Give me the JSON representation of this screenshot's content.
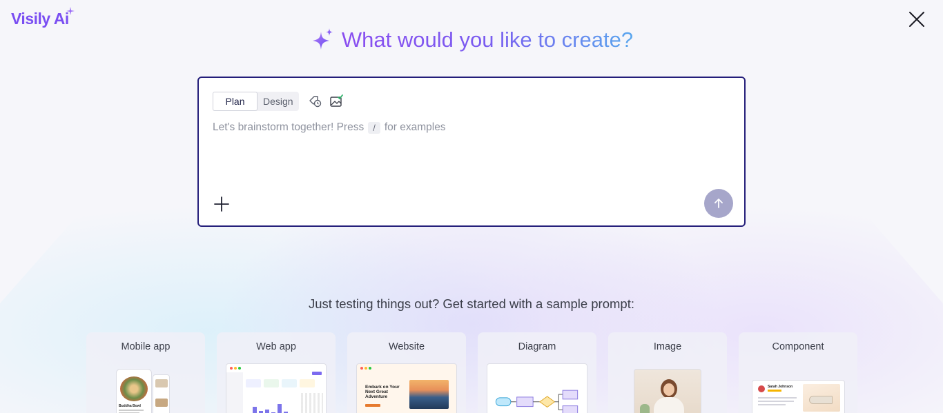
{
  "app": {
    "logo_text": "Visily Ai"
  },
  "headline": {
    "text": "What would you like to create?"
  },
  "prompt": {
    "modes": [
      "Plan",
      "Design"
    ],
    "active_mode": "Plan",
    "placeholder_before": "Let's brainstorm together! Press",
    "placeholder_key": "/",
    "placeholder_after": "for examples"
  },
  "samples": {
    "heading": "Just testing things out? Get started with a sample prompt:",
    "cards": [
      {
        "label": "Mobile app"
      },
      {
        "label": "Web app"
      },
      {
        "label": "Website"
      },
      {
        "label": "Diagram"
      },
      {
        "label": "Image"
      },
      {
        "label": "Component"
      }
    ],
    "mobile_preview_title": "Buddha Bowl",
    "website_preview_headline": "Embark on Your Next Great Adventure",
    "component_preview_name": "Sarah Johnson"
  },
  "colors": {
    "brand": "#7a4ef2",
    "border": "#241e7a",
    "send": "#a6a6ca"
  },
  "icons": [
    "sparkle-icon",
    "close-icon",
    "tag-clock-icon",
    "image-check-icon",
    "plus-icon",
    "arrow-up-icon"
  ]
}
